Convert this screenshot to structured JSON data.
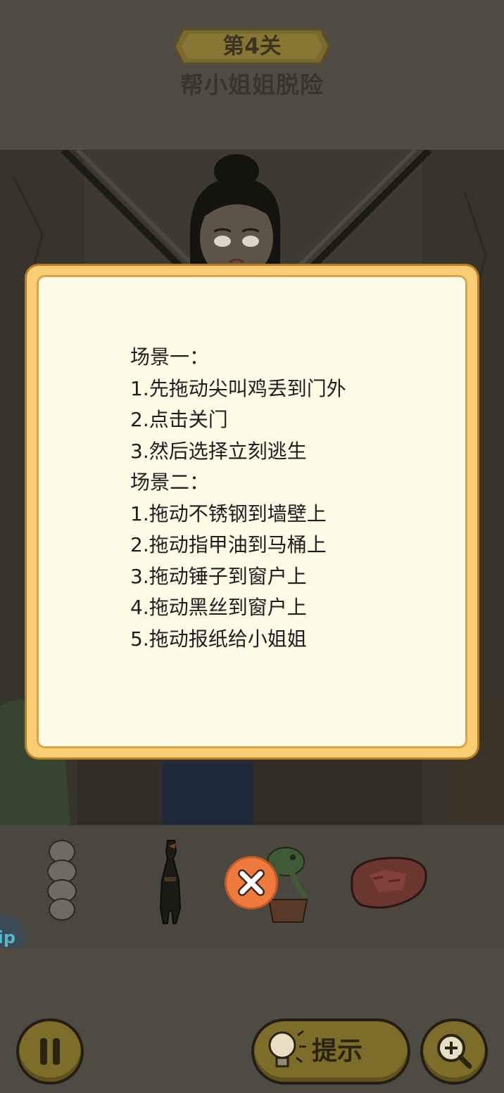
{
  "header": {
    "level_label": "第4关",
    "level_title": "帮小姐姐脱险"
  },
  "side_tab": {
    "label": "ip"
  },
  "items": [
    {
      "name": "garlic-icon"
    },
    {
      "name": "rubber-chicken-icon"
    },
    {
      "name": "potted-plant-icon"
    },
    {
      "name": "steak-icon"
    }
  ],
  "controls": {
    "hint_label": "提示",
    "pause_icon": "pause-icon",
    "zoom_icon": "zoom-in-icon"
  },
  "guide": {
    "lines": [
      "场景一：",
      "1.先拖动尖叫鸡丢到门外",
      "2.点击关门",
      "3.然后选择立刻逃生",
      "场景二：",
      "1.拖动不锈钢到墙壁上",
      "2.拖动指甲油到马桶上",
      "3.拖动锤子到窗户上",
      "4.拖动黑丝到窗户上",
      "5.拖动报纸给小姐姐"
    ]
  },
  "colors": {
    "modal_border": "#f8cd74",
    "modal_fill": "#fefbe7",
    "close_button": "#ef7a3e",
    "button_gold": "#7d6d2a"
  }
}
